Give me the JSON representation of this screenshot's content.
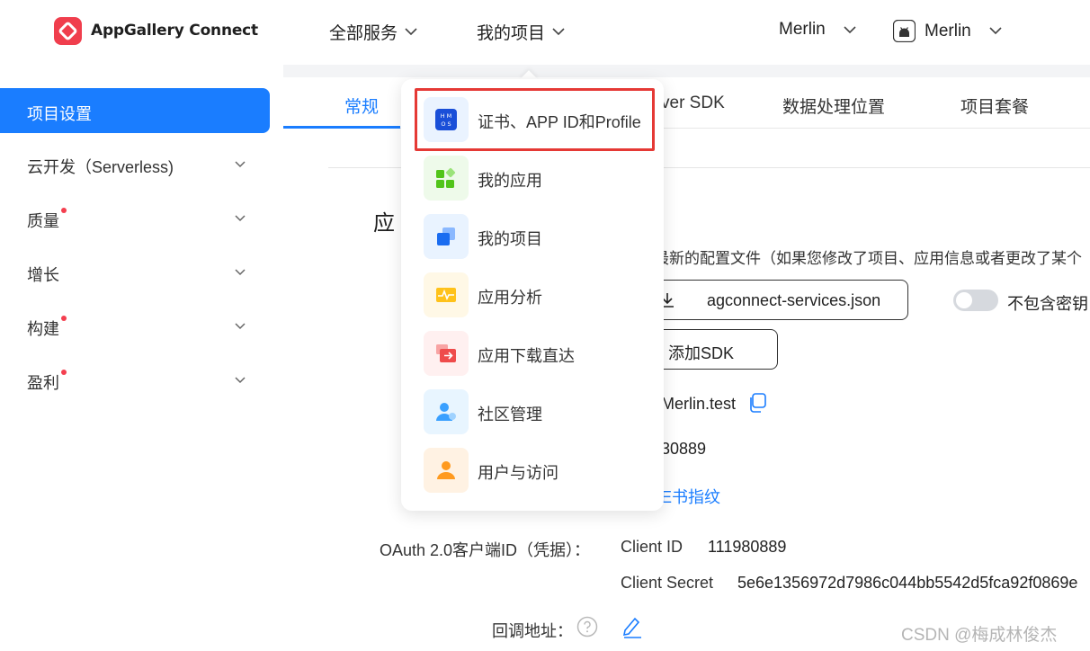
{
  "header": {
    "brand": "AppGallery Connect",
    "nav": [
      {
        "label": "全部服务"
      },
      {
        "label": "我的项目"
      }
    ],
    "account_label": "Merlin",
    "app_label": "Merlin"
  },
  "sidebar": {
    "active": "项目设置",
    "items": [
      {
        "label": "云开发（Serverless)"
      },
      {
        "label": "质量"
      },
      {
        "label": "增长"
      },
      {
        "label": "构建"
      },
      {
        "label": "盈利"
      }
    ]
  },
  "tabs": {
    "general": "常规",
    "sdk_partial": "ver SDK",
    "data_location": "数据处理位置",
    "plan": "项目套餐"
  },
  "content": {
    "section_title_partial": "应",
    "config_desc_partial": "最新的配置文件（如果您修改了项目、应用信息或者更改了某个",
    "download_file": "agconnect-services.json",
    "exclude_key_label": "不包含密钥",
    "add_sdk": "添加SDK",
    "package_partial": "Merlin.test",
    "app_id_partial": "30889",
    "cert_link_partial": "E书指纹",
    "oauth_label": "OAuth 2.0客户端ID（凭据）：",
    "client_id_label": "Client ID",
    "client_id_value": "111980889",
    "client_secret_label": "Client Secret",
    "client_secret_value": "5e6e1356972d7986c044bb5542d5fca92f0869e",
    "callback_label": "回调地址："
  },
  "dropdown": {
    "items": [
      {
        "label": "证书、APP ID和Profile",
        "icon": "hmos-certificate-icon",
        "bg": "#eaf3ff"
      },
      {
        "label": "我的应用",
        "icon": "my-apps-icon",
        "bg": "#eefaea"
      },
      {
        "label": "我的项目",
        "icon": "my-projects-icon",
        "bg": "#e9f3ff"
      },
      {
        "label": "应用分析",
        "icon": "app-analytics-icon",
        "bg": "#fff8e6"
      },
      {
        "label": "应用下载直达",
        "icon": "app-download-icon",
        "bg": "#fff0f0"
      },
      {
        "label": "社区管理",
        "icon": "community-management-icon",
        "bg": "#e8f5ff"
      },
      {
        "label": "用户与访问",
        "icon": "user-access-icon",
        "bg": "#fff2e3"
      }
    ]
  },
  "watermark": "CSDN @梅成林俊杰",
  "colors": {
    "accent": "#1a7dff",
    "highlight": "#e53935",
    "badge": "#f43f4f"
  }
}
